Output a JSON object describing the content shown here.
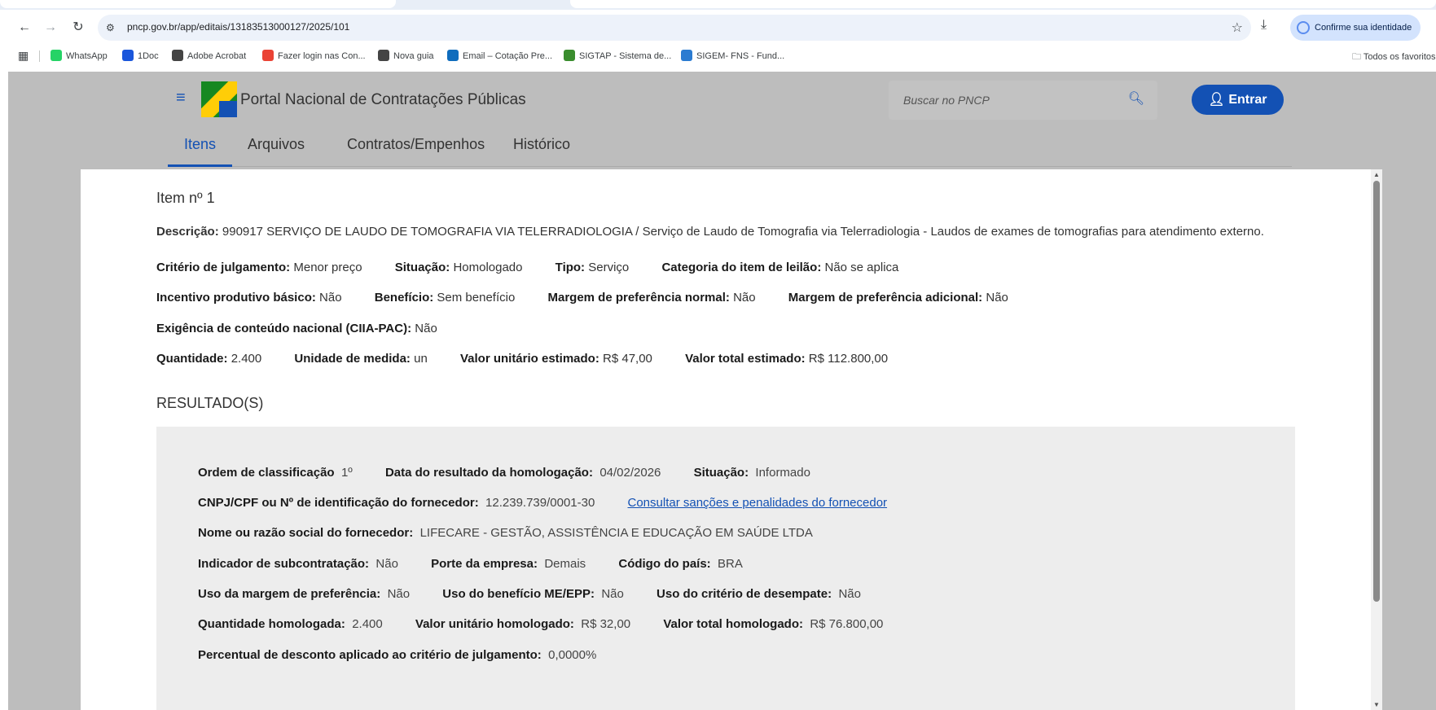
{
  "browser": {
    "url": "pncp.gov.br/app/editais/13183513000127/2025/101",
    "identity_button": "Confirme sua identidade",
    "bookmarks": [
      {
        "label": "WhatsApp",
        "color": "#25d366"
      },
      {
        "label": "1Doc",
        "color": "#1a56db"
      },
      {
        "label": "Adobe Acrobat",
        "color": "#444444"
      },
      {
        "label": "Fazer login nas Con...",
        "color": "#ea4335"
      },
      {
        "label": "Nova guia",
        "color": "#444444"
      },
      {
        "label": "Email – Cotação Pre...",
        "color": "#0f6cbd"
      },
      {
        "label": "SIGTAP - Sistema de...",
        "color": "#3a8d2e"
      },
      {
        "label": "SIGEM- FNS - Fund...",
        "color": "#2b7bd1"
      }
    ],
    "all_bookmarks": "Todos os favoritos"
  },
  "header": {
    "title": "Portal Nacional de Contratações Públicas",
    "search_placeholder": "Buscar no PNCP",
    "login_label": "Entrar"
  },
  "tabs": [
    "Itens",
    "Arquivos",
    "Contratos/Empenhos",
    "Histórico"
  ],
  "item": {
    "title": "Item nº 1",
    "descricao_label": "Descrição:",
    "descricao": "990917 SERVIÇO DE LAUDO DE TOMOGRAFIA VIA TELERRADIOLOGIA / Serviço de Laudo de Tomografia via Telerradiologia - Laudos de exames de tomografias para atendimento externo.",
    "row1": [
      {
        "label": "Critério de julgamento:",
        "value": "Menor preço"
      },
      {
        "label": "Situação:",
        "value": "Homologado"
      },
      {
        "label": "Tipo:",
        "value": "Serviço"
      },
      {
        "label": "Categoria do item de leilão:",
        "value": "Não se aplica"
      }
    ],
    "row2": [
      {
        "label": "Incentivo produtivo básico:",
        "value": "Não"
      },
      {
        "label": "Benefício:",
        "value": "Sem benefício"
      },
      {
        "label": "Margem de preferência normal:",
        "value": "Não"
      },
      {
        "label": "Margem de preferência adicional:",
        "value": "Não"
      }
    ],
    "row3": [
      {
        "label": "Exigência de conteúdo nacional (CIIA-PAC):",
        "value": "Não"
      }
    ],
    "row4": [
      {
        "label": "Quantidade:",
        "value": "2.400"
      },
      {
        "label": "Unidade de medida:",
        "value": "un"
      },
      {
        "label": "Valor unitário estimado:",
        "value": "R$ 47,00"
      },
      {
        "label": "Valor total estimado:",
        "value": "R$ 112.800,00"
      }
    ]
  },
  "resultado": {
    "heading": "RESULTADO(S)",
    "rows": [
      [
        {
          "label": "Ordem de classificação",
          "value": "1º"
        },
        {
          "label": "Data do resultado da homologação:",
          "value": "04/02/2026"
        },
        {
          "label": "Situação:",
          "value": "Informado"
        }
      ],
      [
        {
          "label": "CNPJ/CPF ou Nº de identificação do fornecedor:",
          "value": "12.239.739/0001-30"
        }
      ],
      [
        {
          "label": "Nome ou razão social do fornecedor:",
          "value": "LIFECARE - GESTÃO, ASSISTÊNCIA E EDUCAÇÃO EM SAÚDE LTDA"
        }
      ],
      [
        {
          "label": "Indicador de subcontratação:",
          "value": "Não"
        },
        {
          "label": "Porte da empresa:",
          "value": "Demais"
        },
        {
          "label": "Código do país:",
          "value": "BRA"
        }
      ],
      [
        {
          "label": "Uso da margem de preferência:",
          "value": "Não"
        },
        {
          "label": "Uso do benefício ME/EPP:",
          "value": "Não"
        },
        {
          "label": "Uso do critério de desempate:",
          "value": "Não"
        }
      ],
      [
        {
          "label": "Quantidade homologada:",
          "value": "2.400"
        },
        {
          "label": "Valor unitário homologado:",
          "value": "R$ 32,00"
        },
        {
          "label": "Valor total homologado:",
          "value": "R$ 76.800,00"
        }
      ],
      [
        {
          "label": "Percentual de desconto aplicado ao critério de julgamento:",
          "value": "0,0000%"
        }
      ]
    ],
    "sancoes_link": "Consultar sanções e penalidades do fornecedor"
  }
}
